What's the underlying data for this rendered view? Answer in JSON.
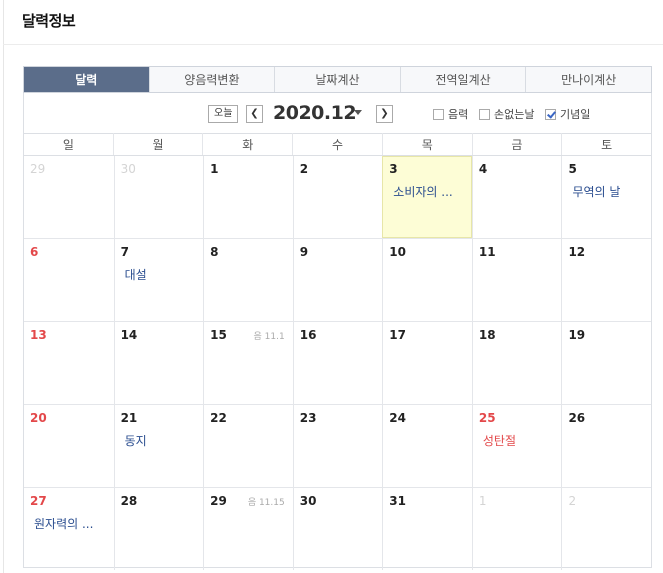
{
  "page": {
    "title": "달력정보"
  },
  "tabs": [
    {
      "label": "달력",
      "active": true
    },
    {
      "label": "양음력변환",
      "active": false
    },
    {
      "label": "날짜계산",
      "active": false
    },
    {
      "label": "전역일계산",
      "active": false
    },
    {
      "label": "만나이계산",
      "active": false
    }
  ],
  "nav": {
    "today_label": "오늘",
    "prev_glyph": "❮",
    "next_glyph": "❯",
    "month": "2020.12",
    "options": [
      {
        "label": "음력",
        "checked": false
      },
      {
        "label": "손없는날",
        "checked": false
      },
      {
        "label": "기념일",
        "checked": true
      }
    ]
  },
  "weekdays": [
    "일",
    "월",
    "화",
    "수",
    "목",
    "금",
    "토"
  ],
  "weeks": [
    [
      {
        "day": "29",
        "other": true
      },
      {
        "day": "30",
        "other": true
      },
      {
        "day": "1"
      },
      {
        "day": "2"
      },
      {
        "day": "3",
        "today": true,
        "event": "소비자의 ..."
      },
      {
        "day": "4"
      },
      {
        "day": "5",
        "event": "무역의 날"
      }
    ],
    [
      {
        "day": "6",
        "sun": true
      },
      {
        "day": "7",
        "event": "대설"
      },
      {
        "day": "8"
      },
      {
        "day": "9"
      },
      {
        "day": "10"
      },
      {
        "day": "11"
      },
      {
        "day": "12"
      }
    ],
    [
      {
        "day": "13",
        "sun": true
      },
      {
        "day": "14"
      },
      {
        "day": "15",
        "lunar": "음 11.1"
      },
      {
        "day": "16"
      },
      {
        "day": "17"
      },
      {
        "day": "18"
      },
      {
        "day": "19"
      }
    ],
    [
      {
        "day": "20",
        "sun": true
      },
      {
        "day": "21",
        "event": "동지"
      },
      {
        "day": "22"
      },
      {
        "day": "23"
      },
      {
        "day": "24"
      },
      {
        "day": "25",
        "sun": true,
        "event": "성탄절",
        "event_red": true
      },
      {
        "day": "26"
      }
    ],
    [
      {
        "day": "27",
        "sun": true,
        "event": "원자력의 ..."
      },
      {
        "day": "28"
      },
      {
        "day": "29",
        "lunar": "음 11.15"
      },
      {
        "day": "30"
      },
      {
        "day": "31"
      },
      {
        "day": "1",
        "other": true
      },
      {
        "day": "2",
        "other": true
      }
    ]
  ]
}
